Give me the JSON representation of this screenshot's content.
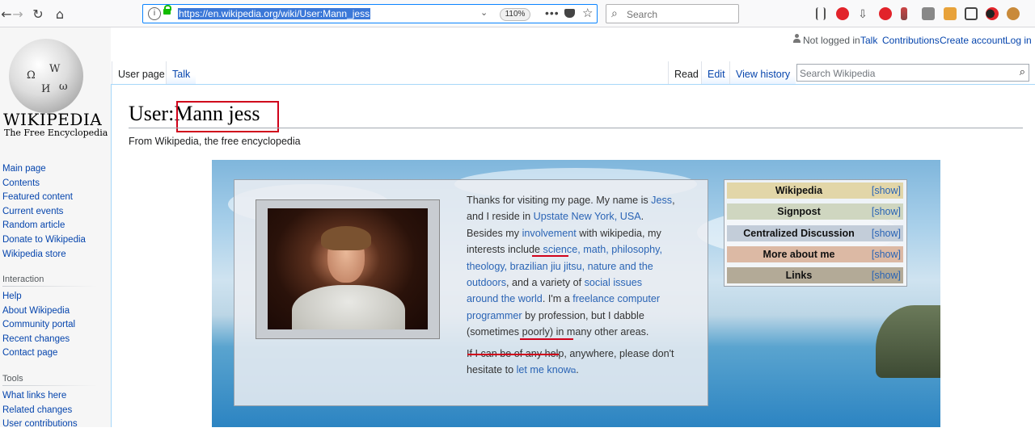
{
  "browser": {
    "url": "https://en.wikipedia.org/wiki/User:Mann_jess",
    "zoom": "110%",
    "search_placeholder": "Search"
  },
  "logo": {
    "wordmark": "WIKIPEDIA",
    "tagline": "The Free Encyclopedia",
    "glyphs": [
      "Ω",
      "W",
      "И",
      "ω"
    ]
  },
  "sidebar": {
    "navigation": [
      "Main page",
      "Contents",
      "Featured content",
      "Current events",
      "Random article",
      "Donate to Wikipedia",
      "Wikipedia store"
    ],
    "interaction_heading": "Interaction",
    "interaction": [
      "Help",
      "About Wikipedia",
      "Community portal",
      "Recent changes",
      "Contact page"
    ],
    "tools_heading": "Tools",
    "tools": [
      "What links here",
      "Related changes",
      "User contributions"
    ]
  },
  "personal": {
    "not_logged_in": "Not logged in",
    "talk": "Talk",
    "contributions": "Contributions",
    "create_account": "Create account",
    "log_in": "Log in"
  },
  "tabs": {
    "user_page": "User page",
    "talk": "Talk",
    "read": "Read",
    "edit": "Edit",
    "view_history": "View history",
    "search_placeholder": "Search Wikipedia"
  },
  "page": {
    "title_prefix": "User:",
    "title_name": "Mann jess",
    "tagline": "From Wikipedia, the free encyclopedia"
  },
  "bio": {
    "p1": [
      {
        "t": "Thanks for visiting my page. My name is ",
        "link": false
      },
      {
        "t": "Jess",
        "link": true
      },
      {
        "t": ", and I reside in ",
        "link": false
      },
      {
        "t": "Upstate New York, USA",
        "link": true
      },
      {
        "t": ". Besides my ",
        "link": false
      },
      {
        "t": "involvement",
        "link": true
      },
      {
        "t": " with wikipedia, my ",
        "link": false
      },
      {
        "t": "interests",
        "link": false
      },
      {
        "t": " include ",
        "link": false
      },
      {
        "t": "science, math, philosophy, theology, brazilian jiu jitsu, nature and the outdoors",
        "link": true
      },
      {
        "t": ", and a variety of ",
        "link": false
      },
      {
        "t": "social issues around the world",
        "link": true
      },
      {
        "t": ". I'm a ",
        "link": false
      },
      {
        "t": "freelance computer programmer",
        "link": true
      },
      {
        "t": " by profession, but I dabble (sometimes poorly) in many other areas.",
        "link": false
      }
    ],
    "p2_text": "If I can be of any help, anywhere, please don't hesitate to ",
    "p2_link": "let me know",
    "p2_end": "."
  },
  "navboxes": [
    {
      "title": "Wikipedia",
      "show": "[show]",
      "color": "#e2d6a8"
    },
    {
      "title": "Signpost",
      "show": "[show]",
      "color": "#cfd6c0"
    },
    {
      "title": "Centralized Discussion",
      "show": "[show]",
      "color": "#c3cdd9"
    },
    {
      "title": "More about me",
      "show": "[show]",
      "color": "#dcb9a4"
    },
    {
      "title": "Links",
      "show": "[show]",
      "color": "#b3aa97"
    }
  ]
}
